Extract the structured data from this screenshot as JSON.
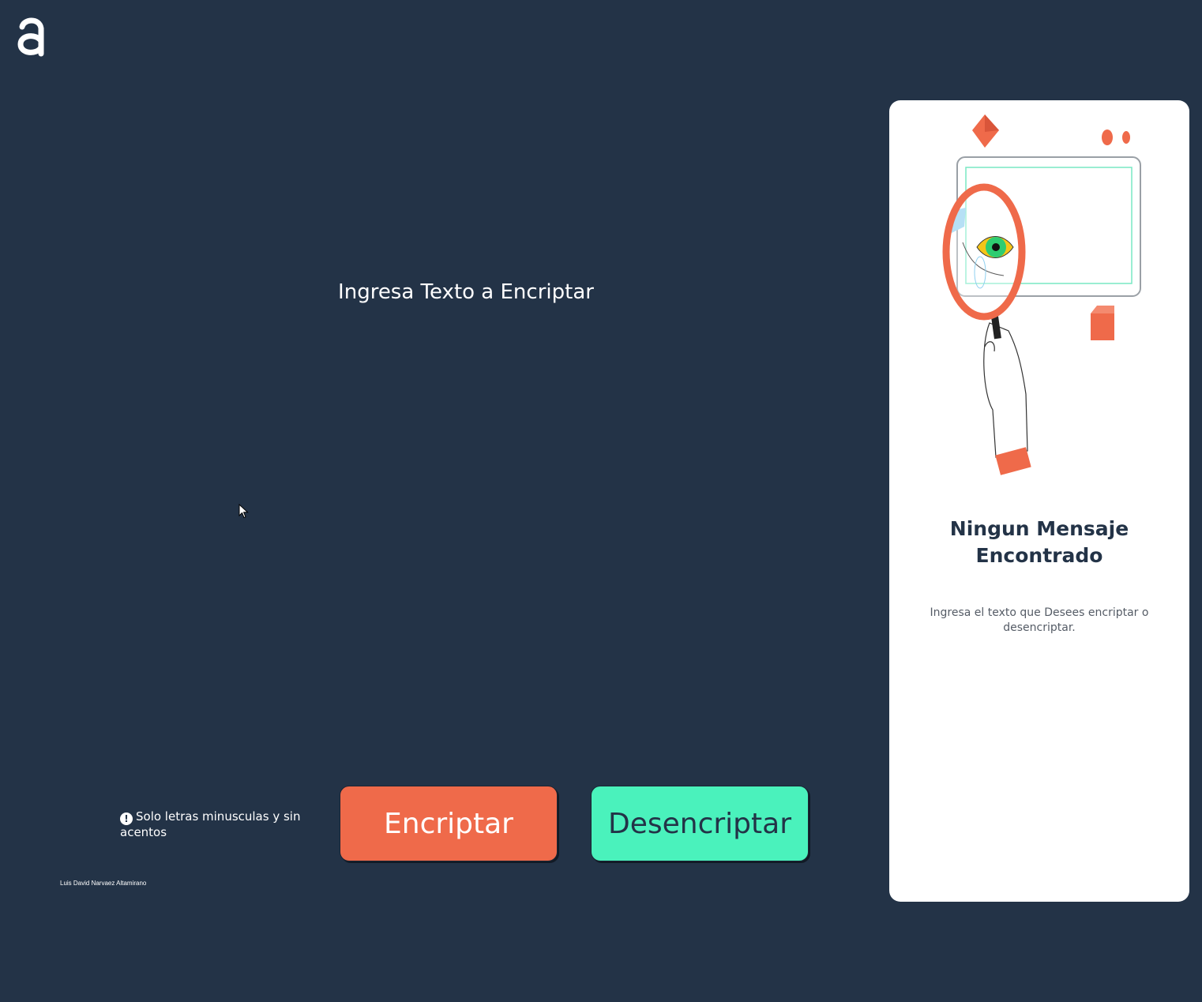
{
  "logo": {
    "icon": "alura-logo-icon",
    "color": "#ffffff"
  },
  "input": {
    "placeholder": "Ingresa Texto a Encriptar",
    "value": ""
  },
  "hint": {
    "icon": "exclamation-icon",
    "text": "Solo letras minusculas y sin acentos"
  },
  "buttons": {
    "encrypt_label": "Encriptar",
    "decrypt_label": "Desencriptar"
  },
  "footer": {
    "author": "Luis David Narvaez Altamirano"
  },
  "output_panel": {
    "illustration": "magnifying-glass-eye-illustration",
    "title": "Ningun Mensaje Encontrado",
    "subtitle": "Ingresa el texto que Desees encriptar o desencriptar."
  },
  "colors": {
    "background": "#233347",
    "encrypt_button": "#ef6a4a",
    "decrypt_button": "#4af2bc",
    "panel": "#ffffff"
  }
}
